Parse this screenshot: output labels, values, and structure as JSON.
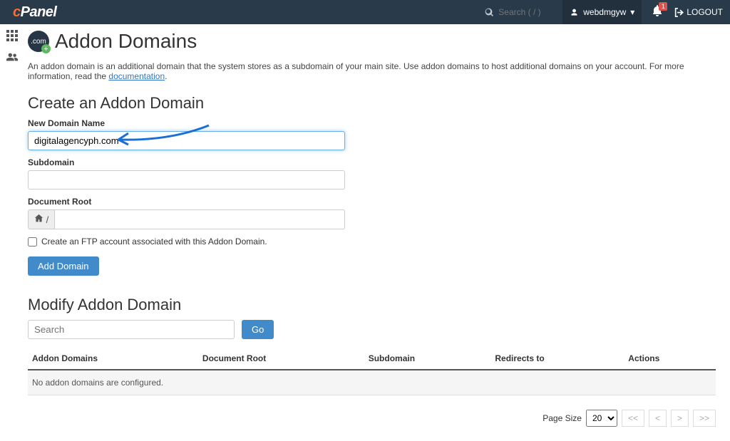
{
  "header": {
    "logo_text": "cPanel",
    "search_placeholder": "Search ( / )",
    "username": "webdmgyw",
    "notification_count": "1",
    "logout_label": "LOGOUT"
  },
  "page": {
    "title": "Addon Domains",
    "icon_text": ".com",
    "description_pre": "An addon domain is an additional domain that the system stores as a subdomain of your main site. Use addon domains to host additional domains on your account. For more information, read the ",
    "doc_link": "documentation",
    "description_post": "."
  },
  "create": {
    "heading": "Create an Addon Domain",
    "new_domain_label": "New Domain Name",
    "new_domain_value": "digitalagencyph.com",
    "subdomain_label": "Subdomain",
    "subdomain_value": "",
    "docroot_label": "Document Root",
    "docroot_prefix_icon": "home",
    "docroot_prefix_text": " /",
    "docroot_value": "",
    "ftp_checkbox_label": "Create an FTP account associated with this Addon Domain.",
    "submit_label": "Add Domain"
  },
  "modify": {
    "heading": "Modify Addon Domain",
    "search_placeholder": "Search",
    "go_label": "Go",
    "columns": [
      "Addon Domains",
      "Document Root",
      "Subdomain",
      "Redirects to",
      "Actions"
    ],
    "empty_message": "No addon domains are configured."
  },
  "pager": {
    "page_size_label": "Page Size",
    "page_size_value": "20",
    "first": "<<",
    "prev": "<",
    "next": ">",
    "last": ">>"
  }
}
